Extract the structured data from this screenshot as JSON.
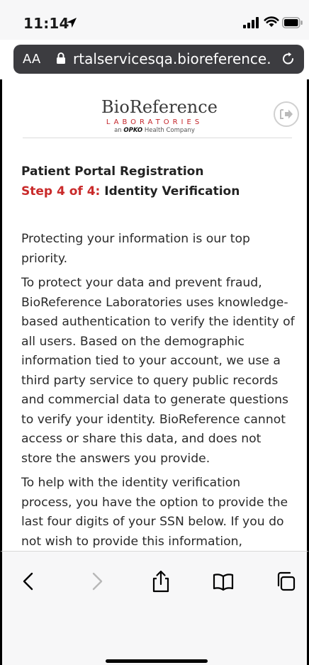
{
  "status_bar": {
    "time": "11:14",
    "icons": [
      "location-arrow-icon",
      "signal-bars-icon",
      "wifi-icon",
      "battery-icon"
    ]
  },
  "browser": {
    "aa_label": "AA",
    "url": "rtalservicesqa.bioreference.com",
    "icons": [
      "lock-icon",
      "reload-icon"
    ]
  },
  "header": {
    "logo_name": "BioReference",
    "logo_laboratories": "LABORATORIES",
    "logo_tagline_prefix": "an",
    "logo_tagline_brand": "OPKO",
    "logo_tagline_suffix": "Health Company",
    "logout_icon": "sign-out-icon"
  },
  "page": {
    "title": "Patient Portal Registration",
    "step_label": "Step 4 of 4:",
    "step_name": "Identity Verification",
    "paragraphs": [
      "Protecting your information is our top priority.",
      "To protect your data and prevent fraud, BioReference Laboratories uses knowledge-based authentication to verify the identity of all users. Based on the demographic information tied to your account, we use a third party service to query public records and commercial data to generate questions to verify your identity. BioReference cannot access or share this data, and does not store the answers you provide.",
      "To help with the identity verification process, you have the option to provide the last four digits of your SSN below. If you do not wish to provide this information,"
    ]
  },
  "toolbar": {
    "buttons": [
      "back-icon",
      "forward-icon",
      "share-icon",
      "bookmarks-icon",
      "tabs-icon"
    ]
  },
  "colors": {
    "accent_red": "#c92a2a",
    "url_bar": "#3c3c40",
    "chrome_bg": "#f7f7f8"
  }
}
